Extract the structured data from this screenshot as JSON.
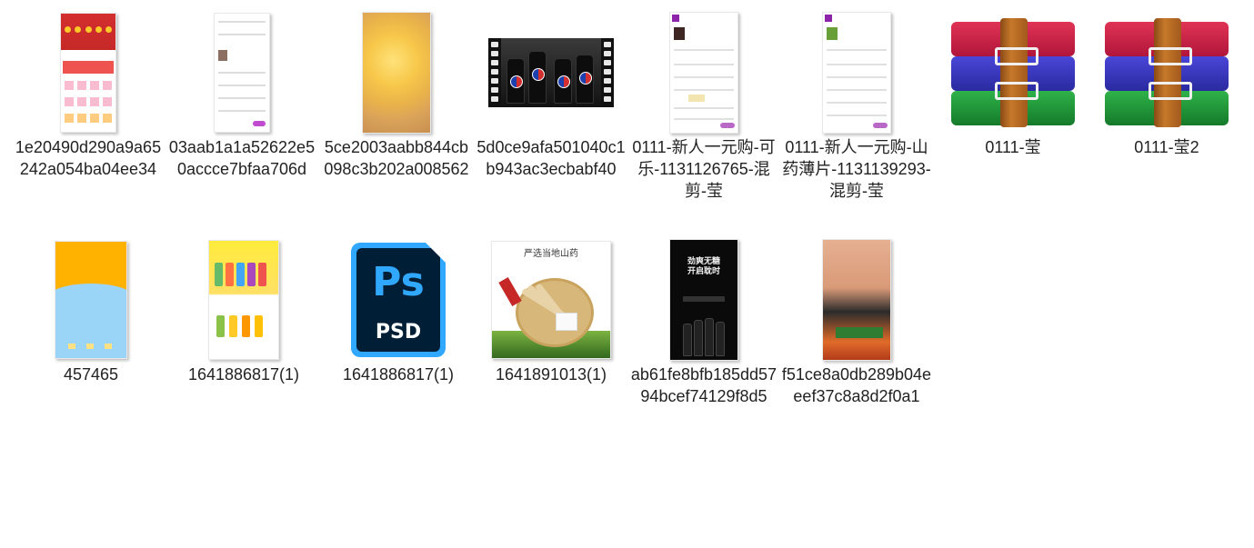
{
  "files": [
    {
      "name": "1e20490d290a9a65242a054ba04ee34",
      "kind": "app-screenshot"
    },
    {
      "name": "03aab1a1a52622e50accce7bfaa706d",
      "kind": "order-screenshot"
    },
    {
      "name": "5ce2003aabb844cb098c3b202a008562",
      "kind": "chips-photo"
    },
    {
      "name": "5d0ce9afa501040c1b943ac3ecbabf40",
      "kind": "video"
    },
    {
      "name": "0111-新人一元购-可乐-1131126765-混剪-莹",
      "kind": "order-screenshot-purple"
    },
    {
      "name": "0111-新人一元购-山药薄片-1131139293-混剪-莹",
      "kind": "order-screenshot-purple"
    },
    {
      "name": "0111-莹",
      "kind": "rar-archive"
    },
    {
      "name": "0111-莹2",
      "kind": "rar-archive"
    },
    {
      "name": "457465",
      "kind": "image"
    },
    {
      "name": "1641886817(1)",
      "kind": "image"
    },
    {
      "name": "1641886817(1)",
      "kind": "psd-file"
    },
    {
      "name": "1641891013(1)",
      "kind": "image"
    },
    {
      "name": "ab61fe8bfb185dd5794bcef74129f8d5",
      "kind": "image"
    },
    {
      "name": "f51ce8a0db289b04eeef37c8a8d2f0a1",
      "kind": "image"
    }
  ],
  "psd": {
    "brand": "Ps",
    "ext": "PSD"
  },
  "yam_title": "严选当地山药",
  "pepsi_text": "劲爽无糖\n开启耽时",
  "colors": {
    "psd_blue": "#31a8ff",
    "psd_navy": "#001e36",
    "accent_purple": "#c04bd0"
  }
}
